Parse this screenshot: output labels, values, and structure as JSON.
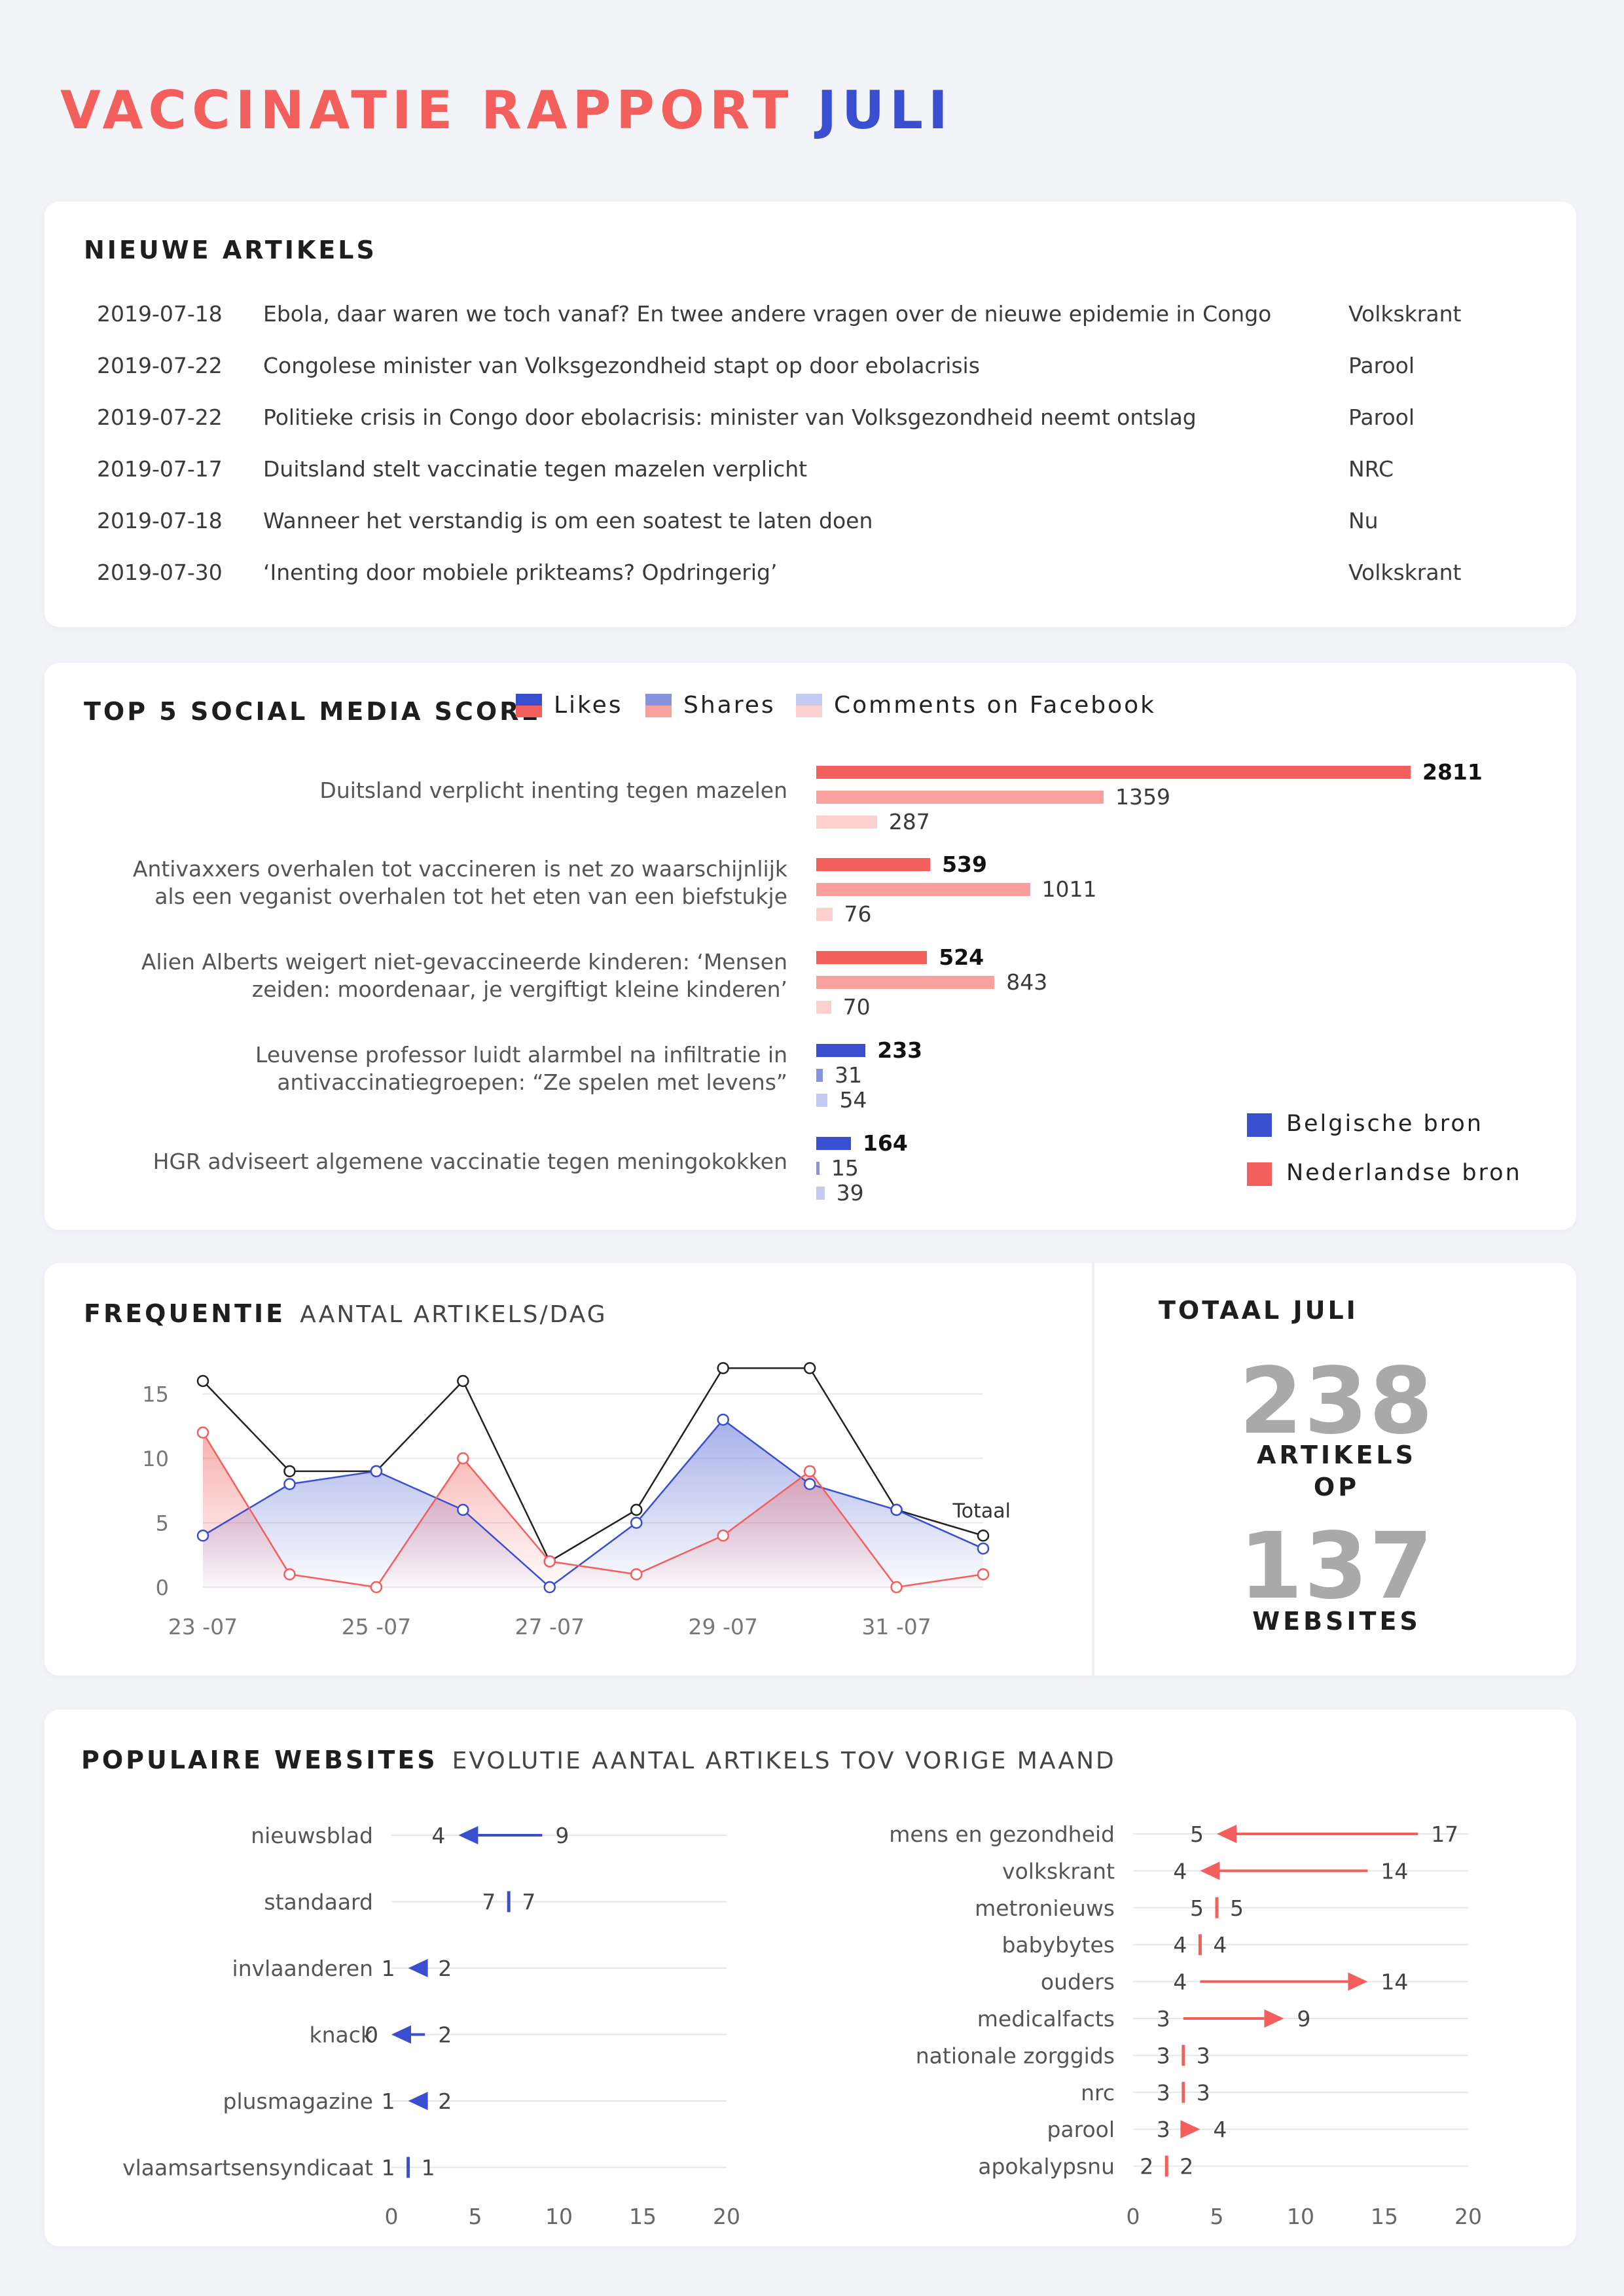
{
  "title": {
    "part1": "VACCINATIE RAPPORT",
    "part2": "JULI"
  },
  "articles": {
    "heading": "NIEUWE ARTIKELS",
    "rows": [
      {
        "date": "2019-07-18",
        "title": "Ebola, daar waren we toch vanaf? En twee andere vragen over de nieuwe epidemie in Congo",
        "source": "Volkskrant"
      },
      {
        "date": "2019-07-22",
        "title": "Congolese minister van Volksgezondheid stapt op door ebolacrisis",
        "source": "Parool"
      },
      {
        "date": "2019-07-22",
        "title": "Politieke crisis in Congo door ebolacrisis: minister van Volksgezondheid neemt ontslag",
        "source": "Parool"
      },
      {
        "date": "2019-07-17",
        "title": "Duitsland stelt vaccinatie tegen mazelen verplicht",
        "source": "NRC"
      },
      {
        "date": "2019-07-18",
        "title": "Wanneer het verstandig is om een soatest te laten doen",
        "source": "Nu"
      },
      {
        "date": "2019-07-30",
        "title": "‘Inenting door mobiele prikteams? Opdringerig’",
        "source": "Volkskrant"
      }
    ]
  },
  "social": {
    "heading": "TOP 5 SOCIAL MEDIA SCORE",
    "legend": [
      "Likes",
      "Shares",
      "Comments on Facebook"
    ],
    "source_legend": {
      "belgian": "Belgische bron",
      "dutch": "Nederlandse bron"
    },
    "colors": {
      "nl": [
        "#f25f5c",
        "#f7a09e",
        "#fbd0cf"
      ],
      "be": [
        "#3a4fcf",
        "#8893e0",
        "#c5cbf0"
      ]
    }
  },
  "frequentie": {
    "heading": "FREQUENTIE",
    "subheading": "AANTAL ARTIKELS/DAG",
    "total_label": "Totaal"
  },
  "totaal": {
    "heading": "TOTAAL JULI",
    "articles_value": "238",
    "articles_label_1": "ARTIKELS",
    "articles_label_2": "OP",
    "websites_value": "137",
    "websites_label": "WEBSITES"
  },
  "websites": {
    "heading": "POPULAIRE WEBSITES",
    "subheading": "EVOLUTIE AANTAL ARTIKELS TOV VORIGE MAAND"
  },
  "chart_data": [
    {
      "type": "bar",
      "title": "TOP 5 SOCIAL MEDIA SCORE",
      "categories": [
        "Duitsland verplicht inenting tegen mazelen",
        "Antivaxxers overhalen tot vaccineren is net zo waarschijnlijk als een veganist overhalen tot het eten van een biefstukje",
        "Alien Alberts weigert niet-gevaccineerde kinderen: ‘Mensen zeiden: moordenaar, je vergiftigt kleine kinderen’",
        "Leuvense professor luidt alarmbel na infiltratie in antivaccinatiegroepen: “Ze spelen met levens”",
        "HGR adviseert algemene vaccinatie tegen meningokokken"
      ],
      "label_lines": [
        [
          "Duitsland verplicht inenting tegen mazelen"
        ],
        [
          "Antivaxxers overhalen tot vaccineren is net zo waarschijnlijk",
          "als een veganist overhalen tot het eten van een biefstukje"
        ],
        [
          "Alien Alberts weigert niet-gevaccineerde kinderen: ‘Mensen",
          "zeiden: moordenaar, je vergiftigt kleine kinderen’"
        ],
        [
          "Leuvense professor luidt alarmbel na infiltratie in",
          "antivaccinatiegroepen: “Ze spelen met levens”"
        ],
        [
          "HGR adviseert algemene vaccinatie tegen meningokokken"
        ]
      ],
      "source": [
        "nl",
        "nl",
        "nl",
        "be",
        "be"
      ],
      "series": [
        {
          "name": "Likes",
          "values": [
            2811,
            539,
            524,
            233,
            164
          ]
        },
        {
          "name": "Shares",
          "values": [
            1359,
            1011,
            843,
            31,
            15
          ]
        },
        {
          "name": "Comments on Facebook",
          "values": [
            287,
            76,
            70,
            54,
            39
          ]
        }
      ]
    },
    {
      "type": "line",
      "title": "FREQUENTIE",
      "x": [
        "23-07",
        "24-07",
        "25-07",
        "26-07",
        "27-07",
        "28-07",
        "29-07",
        "30-07",
        "31-07",
        "01-08"
      ],
      "x_tick_labels": [
        "23 -07",
        "25 -07",
        "27 -07",
        "29 -07",
        "31 -07"
      ],
      "ylim": [
        0,
        16
      ],
      "y_ticks": [
        0,
        5,
        10,
        15
      ],
      "series": [
        {
          "name": "Totaal",
          "values": [
            16,
            9,
            9,
            16,
            2,
            6,
            17,
            17,
            6,
            4
          ],
          "color": "#222222"
        },
        {
          "values": [
            4,
            8,
            9,
            6,
            0,
            5,
            13,
            8,
            6,
            3
          ],
          "color": "#3a4fcf"
        },
        {
          "values": [
            12,
            1,
            0,
            10,
            2,
            1,
            4,
            9,
            0,
            1
          ],
          "color": "#f25f5c"
        }
      ]
    },
    {
      "type": "dumbbell",
      "title": "POPULAIRE WEBSITES",
      "xlim": [
        0,
        20
      ],
      "x_ticks": [
        0,
        5,
        10,
        15,
        20
      ],
      "color": "#3a4fcf",
      "rows": [
        {
          "name": "nieuwsblad",
          "previous": 9,
          "current": 4
        },
        {
          "name": "standaard",
          "previous": 7,
          "current": 7
        },
        {
          "name": "invlaanderen",
          "previous": 2,
          "current": 1
        },
        {
          "name": "knack",
          "previous": 2,
          "current": 0
        },
        {
          "name": "plusmagazine",
          "previous": 2,
          "current": 1
        },
        {
          "name": "vlaamsartsensyndicaat",
          "previous": 1,
          "current": 1
        }
      ]
    },
    {
      "type": "dumbbell",
      "title": "POPULAIRE WEBSITES",
      "xlim": [
        0,
        20
      ],
      "x_ticks": [
        0,
        5,
        10,
        15,
        20
      ],
      "color": "#f25f5c",
      "rows": [
        {
          "name": "mens en gezondheid",
          "previous": 17,
          "current": 5
        },
        {
          "name": "volkskrant",
          "previous": 14,
          "current": 4
        },
        {
          "name": "metronieuws",
          "previous": 5,
          "current": 5
        },
        {
          "name": "babybytes",
          "previous": 4,
          "current": 4
        },
        {
          "name": "ouders",
          "previous": 4,
          "current": 14
        },
        {
          "name": "medicalfacts",
          "previous": 3,
          "current": 9
        },
        {
          "name": "nationale zorggids",
          "previous": 3,
          "current": 3
        },
        {
          "name": "nrc",
          "previous": 3,
          "current": 3
        },
        {
          "name": "parool",
          "previous": 3,
          "current": 4
        },
        {
          "name": "apokalypsnu",
          "previous": 2,
          "current": 2
        }
      ]
    }
  ]
}
